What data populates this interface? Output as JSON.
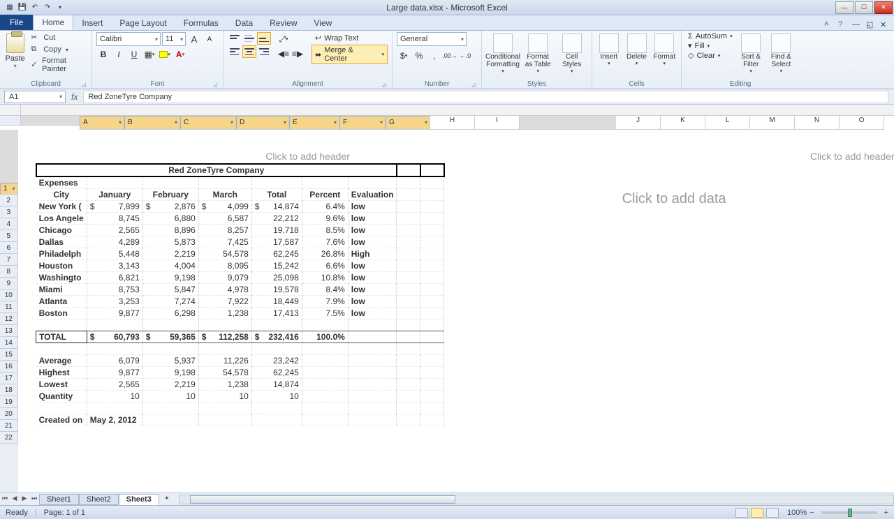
{
  "window": {
    "title": "Large data.xlsx - Microsoft Excel"
  },
  "tabs": {
    "file": "File",
    "items": [
      "Home",
      "Insert",
      "Page Layout",
      "Formulas",
      "Data",
      "Review",
      "View"
    ],
    "active": "Home"
  },
  "ribbon": {
    "clipboard": {
      "paste": "Paste",
      "cut": "Cut",
      "copy": "Copy",
      "format_painter": "Format Painter",
      "group": "Clipboard"
    },
    "font": {
      "name": "Calibri",
      "size": "11",
      "group": "Font"
    },
    "alignment": {
      "wrap": "Wrap Text",
      "merge": "Merge & Center",
      "group": "Alignment"
    },
    "number": {
      "format": "General",
      "group": "Number"
    },
    "styles": {
      "cond": "Conditional Formatting",
      "table": "Format as Table",
      "cell": "Cell Styles",
      "group": "Styles"
    },
    "cells": {
      "insert": "Insert",
      "delete": "Delete",
      "format": "Format",
      "group": "Cells"
    },
    "editing": {
      "autosum": "AutoSum",
      "fill": "Fill",
      "clear": "Clear",
      "sort": "Sort & Filter",
      "find": "Find & Select",
      "group": "Editing"
    }
  },
  "namebox": "A1",
  "formula": "Red ZoneTyre Company",
  "columns": [
    "A",
    "B",
    "C",
    "D",
    "E",
    "F",
    "G",
    "H",
    "I",
    "J",
    "K",
    "L",
    "M",
    "N",
    "O"
  ],
  "sheet": {
    "title": "Red ZoneTyre Company",
    "expenses_label": "Expenses",
    "headers": [
      "City",
      "January",
      "February",
      "March",
      "Total",
      "Percent",
      "Evaluation"
    ],
    "rows": [
      {
        "city": "New York (",
        "jan": "7,899",
        "feb": "2,876",
        "mar": "4,099",
        "total": "14,874",
        "pct": "6.4%",
        "eval": "low",
        "cur": true
      },
      {
        "city": "Los Angele",
        "jan": "8,745",
        "feb": "6,880",
        "mar": "6,587",
        "total": "22,212",
        "pct": "9.6%",
        "eval": "low"
      },
      {
        "city": "Chicago",
        "jan": "2,565",
        "feb": "8,896",
        "mar": "8,257",
        "total": "19,718",
        "pct": "8.5%",
        "eval": "low"
      },
      {
        "city": "Dallas",
        "jan": "4,289",
        "feb": "5,873",
        "mar": "7,425",
        "total": "17,587",
        "pct": "7.6%",
        "eval": "low"
      },
      {
        "city": "Philadelph",
        "jan": "5,448",
        "feb": "2,219",
        "mar": "54,578",
        "total": "62,245",
        "pct": "26.8%",
        "eval": "High"
      },
      {
        "city": "Houston",
        "jan": "3,143",
        "feb": "4,004",
        "mar": "8,095",
        "total": "15,242",
        "pct": "6.6%",
        "eval": "low"
      },
      {
        "city": "Washingto",
        "jan": "6,821",
        "feb": "9,198",
        "mar": "9,079",
        "total": "25,098",
        "pct": "10.8%",
        "eval": "low"
      },
      {
        "city": "Miami",
        "jan": "8,753",
        "feb": "5,847",
        "mar": "4,978",
        "total": "19,578",
        "pct": "8.4%",
        "eval": "low"
      },
      {
        "city": "Atlanta",
        "jan": "3,253",
        "feb": "7,274",
        "mar": "7,922",
        "total": "18,449",
        "pct": "7.9%",
        "eval": "low"
      },
      {
        "city": "Boston",
        "jan": "9,877",
        "feb": "6,298",
        "mar": "1,238",
        "total": "17,413",
        "pct": "7.5%",
        "eval": "low"
      }
    ],
    "total": {
      "label": "TOTAL",
      "jan": "60,793",
      "feb": "59,365",
      "mar": "112,258",
      "total": "232,416",
      "pct": "100.0%"
    },
    "stats": [
      {
        "label": "Average",
        "jan": "6,079",
        "feb": "5,937",
        "mar": "11,226",
        "total": "23,242"
      },
      {
        "label": "Highest",
        "jan": "9,877",
        "feb": "9,198",
        "mar": "54,578",
        "total": "62,245"
      },
      {
        "label": "Lowest",
        "jan": "2,565",
        "feb": "2,219",
        "mar": "1,238",
        "total": "14,874"
      },
      {
        "label": "Quantity",
        "jan": "10",
        "feb": "10",
        "mar": "10",
        "total": "10"
      }
    ],
    "created_label": "Created on",
    "created_value": "May 2, 2012"
  },
  "placeholders": {
    "header": "Click to add header",
    "data": "Click to add data"
  },
  "sheets": {
    "items": [
      "Sheet1",
      "Sheet2",
      "Sheet3"
    ],
    "active": "Sheet3"
  },
  "status": {
    "ready": "Ready",
    "page": "Page: 1 of 1",
    "zoom": "100%"
  }
}
